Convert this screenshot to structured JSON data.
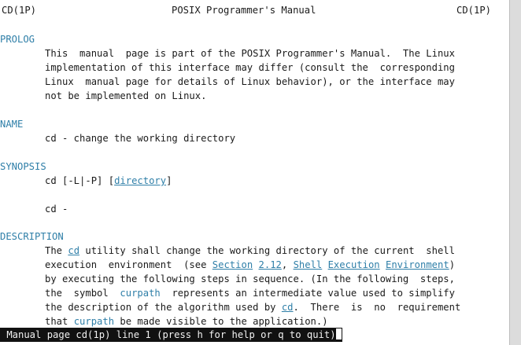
{
  "header": {
    "left": "CD(1P)",
    "center": "POSIX Programmer's Manual",
    "right": "CD(1P)"
  },
  "sections": {
    "prolog": {
      "title": "PROLOG",
      "lines": [
        "This  manual  page is part of the POSIX Programmer's Manual.  The Linux",
        "implementation of this interface may differ (consult the  corresponding",
        "Linux  manual page for details of Linux behavior), or the interface may",
        "not be implemented on Linux."
      ]
    },
    "name": {
      "title": "NAME",
      "line": "cd - change the working directory"
    },
    "synopsis": {
      "title": "SYNOPSIS",
      "line1_prefix": "cd [-L|-P] ",
      "line1_open": "[",
      "line1_link": "directory",
      "line1_close": "]",
      "line2": "cd -"
    },
    "description": {
      "title": "DESCRIPTION",
      "l1_a": "The ",
      "l1_cd": "cd",
      "l1_b": " utility shall change the working directory of the current  shell",
      "l2_a": "execution  environment  (see ",
      "l2_section": "Section",
      "l2_sp1": " ",
      "l2_num": "2.12",
      "l2_comma": ", ",
      "l2_shell": "Shell",
      "l2_sp2": " ",
      "l2_exec": "Execution",
      "l2_sp3": " ",
      "l2_env": "Environment",
      "l2_close": ")",
      "l3": "by executing the following steps in sequence. (In the following  steps,",
      "l4_a": "the  symbol  ",
      "l4_curpath": "curpath",
      "l4_b": "  represents an intermediate value used to simplify",
      "l5_a": "the description of the algorithm used by ",
      "l5_cd": "cd",
      "l5_b": ".  There  is  no  requirement",
      "l6_a": "that ",
      "l6_curpath": "curpath",
      "l6_b": " be made visible to the application.)"
    }
  },
  "status_bar": {
    "text": " Manual page cd(1p) line 1 (press h for help or q to quit)"
  },
  "colors": {
    "section_heading": "#2f7fa8",
    "link": "#2f7fa8",
    "status_bg": "#111111",
    "status_fg": "#f2f2f2"
  }
}
